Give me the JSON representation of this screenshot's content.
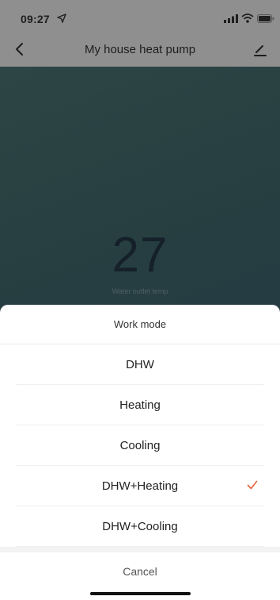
{
  "status_bar": {
    "time": "09:27"
  },
  "navbar": {
    "title": "My house heat pump",
    "back_icon": "chevron-left-icon",
    "edit_icon": "pen-edit-icon"
  },
  "main": {
    "temperature": "27",
    "temperature_label": "Water outlet temp"
  },
  "sheet": {
    "title": "Work mode",
    "options": [
      {
        "label": "DHW",
        "selected": false
      },
      {
        "label": "Heating",
        "selected": false
      },
      {
        "label": "Cooling",
        "selected": false
      },
      {
        "label": "DHW+Heating",
        "selected": true
      },
      {
        "label": "DHW+Cooling",
        "selected": false
      }
    ],
    "cancel_label": "Cancel"
  },
  "colors": {
    "accent_check": "#e8643b",
    "background_gradient_start": "#314a48",
    "background_gradient_end": "#203646"
  }
}
